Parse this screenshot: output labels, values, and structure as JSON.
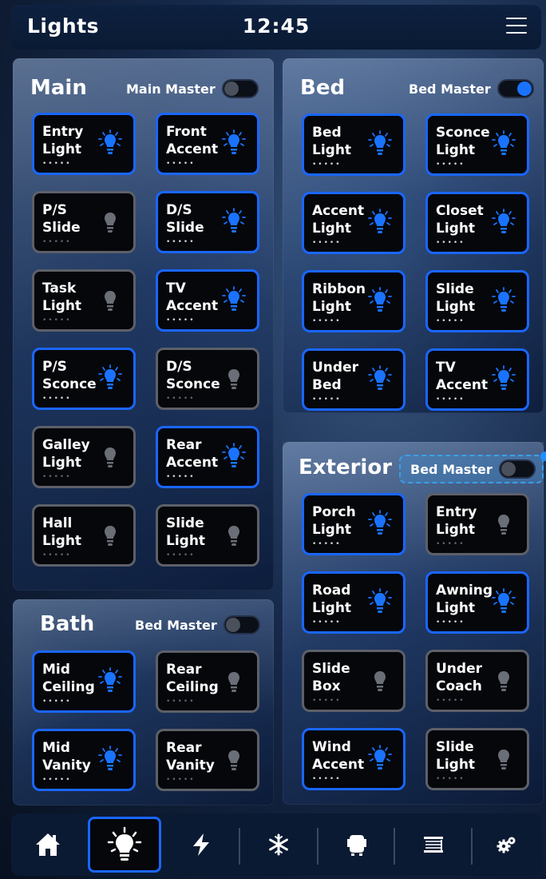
{
  "header": {
    "title": "Lights",
    "time": "12:45"
  },
  "panels": {
    "main": {
      "title": "Main",
      "master": {
        "label": "Main Master",
        "on": false
      },
      "tiles": [
        {
          "label": "Entry\nLight",
          "on": true
        },
        {
          "label": "Front\nAccent",
          "on": true
        },
        {
          "label": "P/S\nSlide",
          "on": false
        },
        {
          "label": "D/S\nSlide",
          "on": true
        },
        {
          "label": "Task\nLight",
          "on": false
        },
        {
          "label": "TV\nAccent",
          "on": true
        },
        {
          "label": "P/S\nSconce",
          "on": true
        },
        {
          "label": "D/S\nSconce",
          "on": false
        },
        {
          "label": "Galley\nLight",
          "on": false
        },
        {
          "label": "Rear\nAccent",
          "on": true
        },
        {
          "label": "Hall\nLight",
          "on": false
        },
        {
          "label": "Slide\nLight",
          "on": false
        }
      ]
    },
    "bed": {
      "title": "Bed",
      "master": {
        "label": "Bed Master",
        "on": true
      },
      "tiles": [
        {
          "label": "Bed\nLight",
          "on": true
        },
        {
          "label": "Sconce\nLight",
          "on": true
        },
        {
          "label": "Accent\nLight",
          "on": true
        },
        {
          "label": "Closet\nLight",
          "on": true
        },
        {
          "label": "Ribbon\nLight",
          "on": true
        },
        {
          "label": "Slide\nLight",
          "on": true
        },
        {
          "label": "Under\nBed",
          "on": true
        },
        {
          "label": "TV\nAccent",
          "on": true
        }
      ]
    },
    "exterior": {
      "title": "Exterior",
      "master": {
        "label": "Bed Master",
        "on": false
      },
      "tiles": [
        {
          "label": "Porch\nLight",
          "on": true
        },
        {
          "label": "Entry\nLight",
          "on": false
        },
        {
          "label": "Road\nLight",
          "on": true
        },
        {
          "label": "Awning\nLight",
          "on": true
        },
        {
          "label": "Slide\nBox",
          "on": false
        },
        {
          "label": "Under\nCoach",
          "on": false
        },
        {
          "label": "Wind\nAccent",
          "on": true
        },
        {
          "label": "Slide\nLight",
          "on": false
        }
      ]
    },
    "bath": {
      "title": "Bath",
      "master": {
        "label": "Bed Master",
        "on": false
      },
      "tiles": [
        {
          "label": "Mid\nCeiling",
          "on": true
        },
        {
          "label": "Rear\nCeiling",
          "on": false
        },
        {
          "label": "Mid\nVanity",
          "on": true
        },
        {
          "label": "Rear\nVanity",
          "on": false
        }
      ]
    }
  },
  "tile_dots": "•••••",
  "nav": {
    "active": "lights-icon",
    "items": [
      "home-icon",
      "lights-icon",
      "power-icon",
      "climate-icon",
      "slideout-icon",
      "shades-icon",
      "settings-icon"
    ]
  },
  "colors": {
    "accent": "#1a66ff",
    "bulb_on": "#1a73ff",
    "bulb_off": "#6a6e76",
    "tile_bg": "#05070b"
  }
}
